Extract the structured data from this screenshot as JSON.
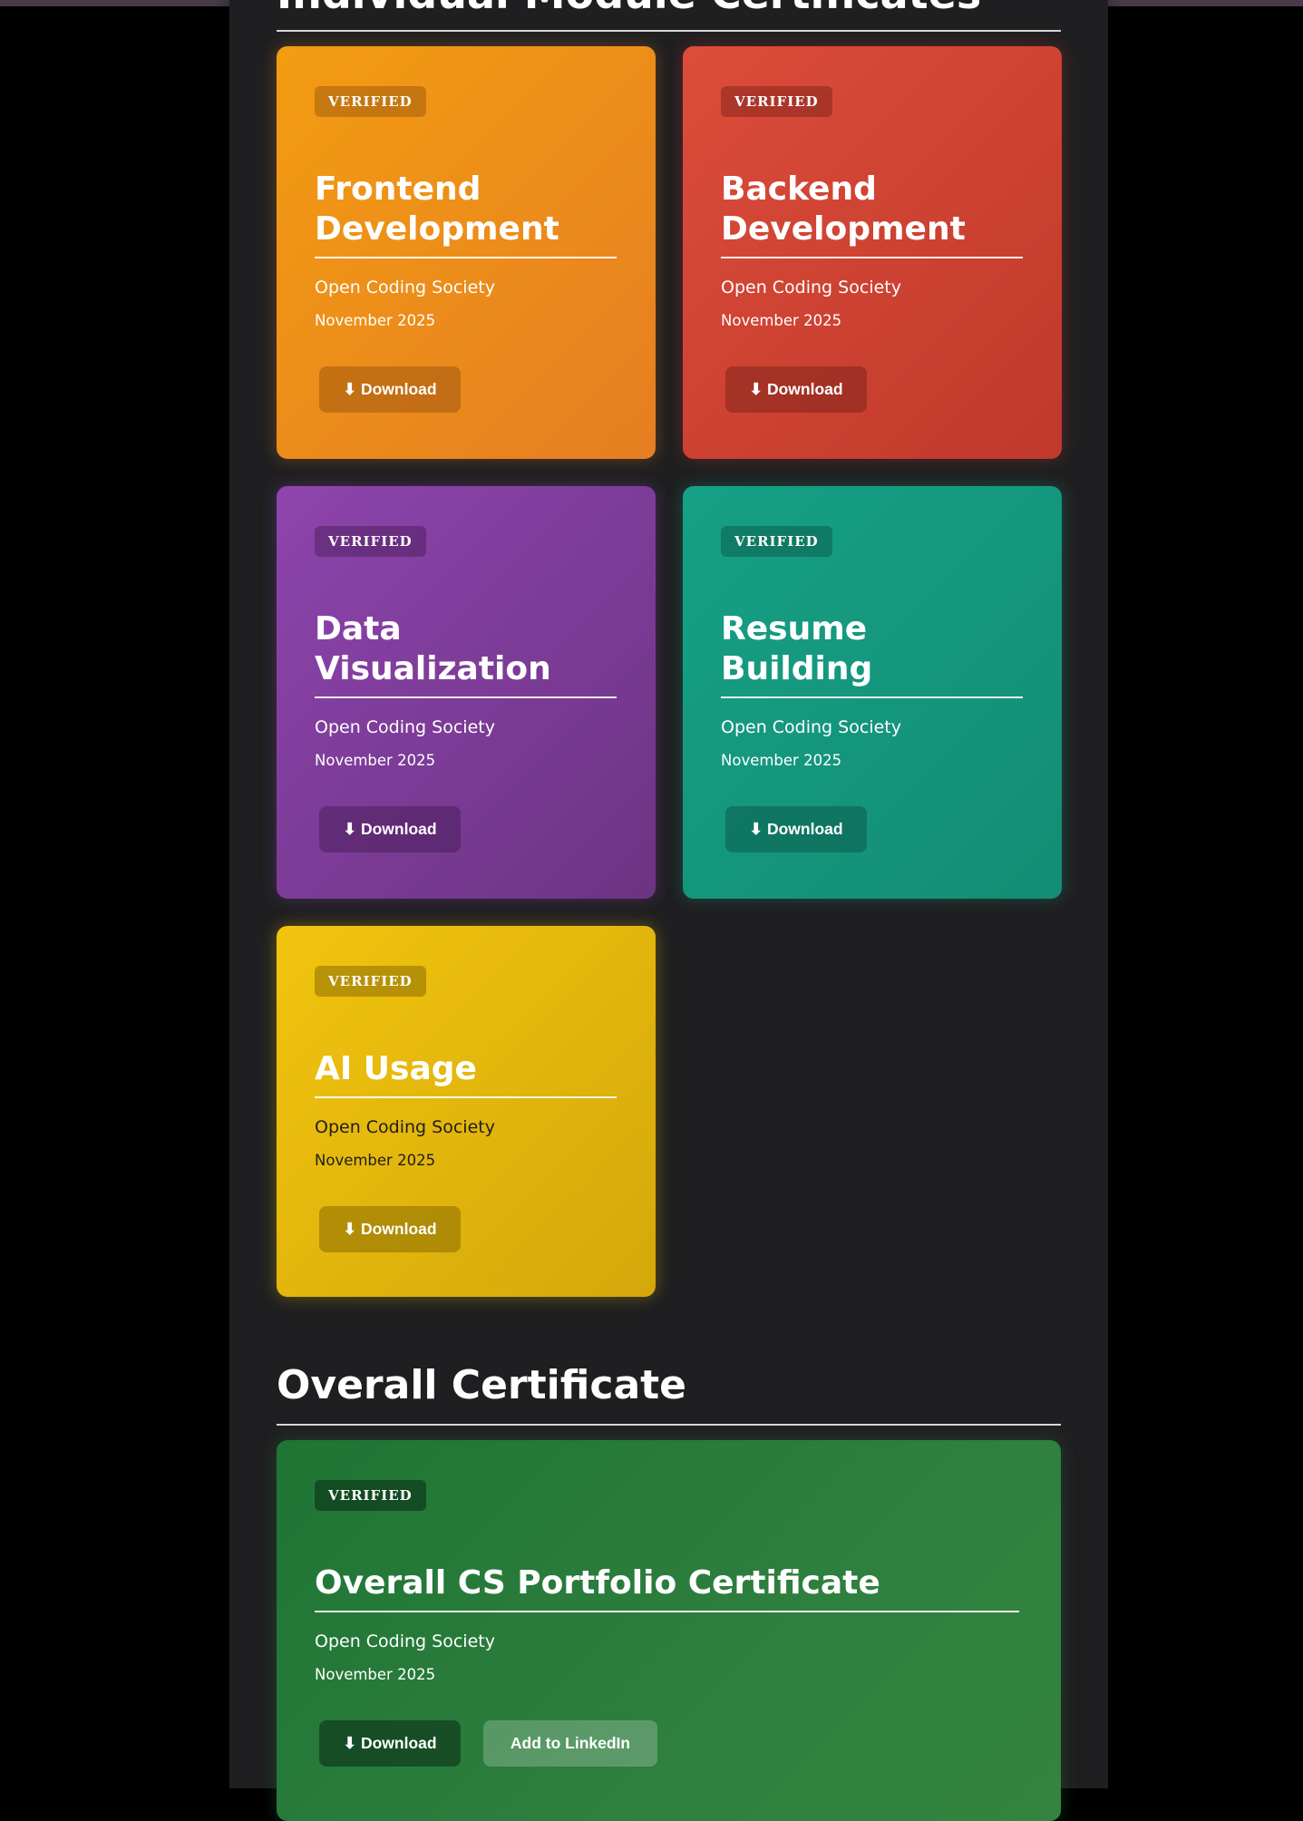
{
  "sections": {
    "modules_title": "Individual Module Certificates",
    "overall_title": "Overall Certificate"
  },
  "cards": [
    {
      "badge": "VERIFIED",
      "title": "Frontend Development",
      "org": "Open Coding Society",
      "date": "November 2025",
      "download": "⬇ Download",
      "color": "#f39c12"
    },
    {
      "badge": "VERIFIED",
      "title": "Backend Development",
      "org": "Open Coding Society",
      "date": "November 2025",
      "download": "⬇ Download",
      "color": "#dc4c3a"
    },
    {
      "badge": "VERIFIED",
      "title": "Data Visualization",
      "org": "Open Coding Society",
      "date": "November 2025",
      "download": "⬇ Download",
      "color": "#8e44ad"
    },
    {
      "badge": "VERIFIED",
      "title": "Resume Building",
      "org": "Open Coding Society",
      "date": "November 2025",
      "download": "⬇ Download",
      "color": "#16a085"
    },
    {
      "badge": "VERIFIED",
      "title": "AI Usage",
      "org": "Open Coding Society",
      "date": "November 2025",
      "download": "⬇ Download",
      "color": "#f1c40f"
    }
  ],
  "overall": {
    "badge": "VERIFIED",
    "title": "Overall CS Portfolio Certificate",
    "org": "Open Coding Society",
    "date": "November 2025",
    "download": "⬇ Download",
    "linkedin": "Add to LinkedIn",
    "color": "#237a36"
  }
}
